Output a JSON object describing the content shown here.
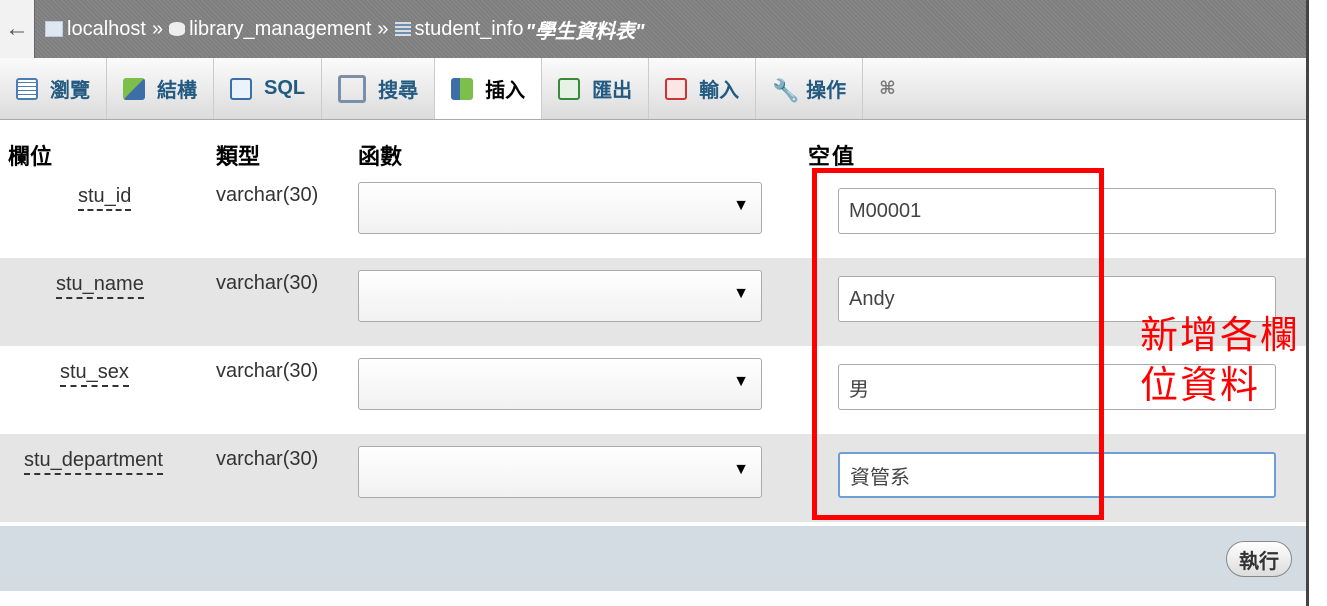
{
  "breadcrumb": {
    "back": "←",
    "server": "localhost",
    "database": "library_management",
    "table": "student_info",
    "comment": "\"學生資料表\"",
    "separator": "»"
  },
  "tabs": [
    {
      "label": "瀏覽",
      "icon": "browse-icon"
    },
    {
      "label": "結構",
      "icon": "structure-icon"
    },
    {
      "label": "SQL",
      "icon": "sql-icon"
    },
    {
      "label": "搜尋",
      "icon": "search-icon"
    },
    {
      "label": "插入",
      "icon": "insert-icon",
      "active": true
    },
    {
      "label": "匯出",
      "icon": "export-icon"
    },
    {
      "label": "輸入",
      "icon": "import-icon"
    },
    {
      "label": "操作",
      "icon": "wrench-icon"
    }
  ],
  "header": {
    "field": "欄位",
    "type": "類型",
    "function": "函數",
    "null": "空",
    "value": "值"
  },
  "rows": [
    {
      "field": "stu_id",
      "type": "varchar(30)",
      "value": "M00001"
    },
    {
      "field": "stu_name",
      "type": "varchar(30)",
      "value": "Andy"
    },
    {
      "field": "stu_sex",
      "type": "varchar(30)",
      "value": "男"
    },
    {
      "field": "stu_department",
      "type": "varchar(30)",
      "value": "資管系"
    }
  ],
  "go_label": "執行",
  "annotation": {
    "line1": "新增各欄",
    "line2": "位資料"
  },
  "colors": {
    "highlight": "#ff0000",
    "link": "#235a81"
  }
}
